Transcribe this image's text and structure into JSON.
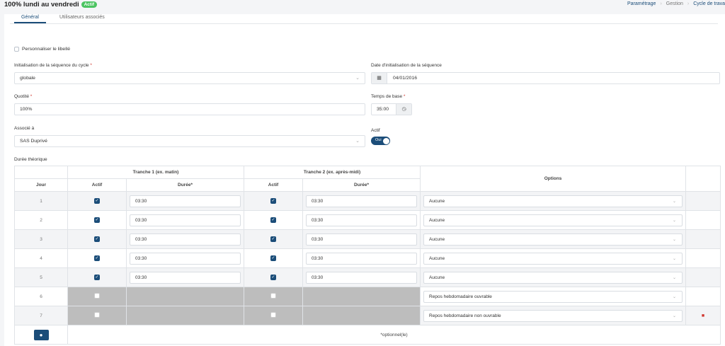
{
  "header": {
    "title": "100% lundi au vendredi",
    "badge": "Actif",
    "breadcrumb": [
      "Paramétrage",
      "Gestion",
      "Cycle de trava"
    ]
  },
  "tabs": [
    {
      "label": "Général",
      "active": true
    },
    {
      "label": "Utilisateurs associés",
      "active": false
    }
  ],
  "form": {
    "personnaliser_label": "Personnaliser le libellé",
    "init_sequence_label": "Initialisation de la séquence du cycle",
    "init_sequence_value": "globale",
    "date_init_label": "Date d'initialisation de la séquence",
    "date_init_value": "04/01/2016",
    "quotite_label": "Quotité",
    "quotite_value": "100%",
    "temps_base_label": "Temps de base",
    "temps_base_value": "35:00",
    "associe_label": "Associé à",
    "associe_value": "SAS Duprivé",
    "actif_label": "Actif",
    "actif_toggle": "Oui",
    "duree_label": "Durée théorique"
  },
  "table": {
    "col_jour": "Jour",
    "tranche1": "Tranche 1 (ex. matin)",
    "tranche2": "Tranche 2 (ex. après-midi)",
    "col_actif": "Actif",
    "col_duree": "Durée*",
    "col_options": "Options",
    "rows": [
      {
        "jour": "1",
        "t1_actif": true,
        "t1_duree": "03:30",
        "t2_actif": true,
        "t2_duree": "03:30",
        "option": "Aucune",
        "deletable": false
      },
      {
        "jour": "2",
        "t1_actif": true,
        "t1_duree": "03:30",
        "t2_actif": true,
        "t2_duree": "03:30",
        "option": "Aucune",
        "deletable": false
      },
      {
        "jour": "3",
        "t1_actif": true,
        "t1_duree": "03:30",
        "t2_actif": true,
        "t2_duree": "03:30",
        "option": "Aucune",
        "deletable": false
      },
      {
        "jour": "4",
        "t1_actif": true,
        "t1_duree": "03:30",
        "t2_actif": true,
        "t2_duree": "03:30",
        "option": "Aucune",
        "deletable": false
      },
      {
        "jour": "5",
        "t1_actif": true,
        "t1_duree": "03:30",
        "t2_actif": true,
        "t2_duree": "03:30",
        "option": "Aucune",
        "deletable": false
      },
      {
        "jour": "6",
        "t1_actif": false,
        "t1_duree": "",
        "t2_actif": false,
        "t2_duree": "",
        "option": "Repos hebdomadaire ouvrable",
        "deletable": false
      },
      {
        "jour": "7",
        "t1_actif": false,
        "t1_duree": "",
        "t2_actif": false,
        "t2_duree": "",
        "option": "Repos hebdomadaire non ouvrable",
        "deletable": true
      }
    ],
    "footer_note": "*optionnel(le)"
  },
  "colors": {
    "primary": "#1b4d79",
    "success": "#4bc461",
    "danger": "#d0342c",
    "disabled": "#bdbdbd"
  }
}
